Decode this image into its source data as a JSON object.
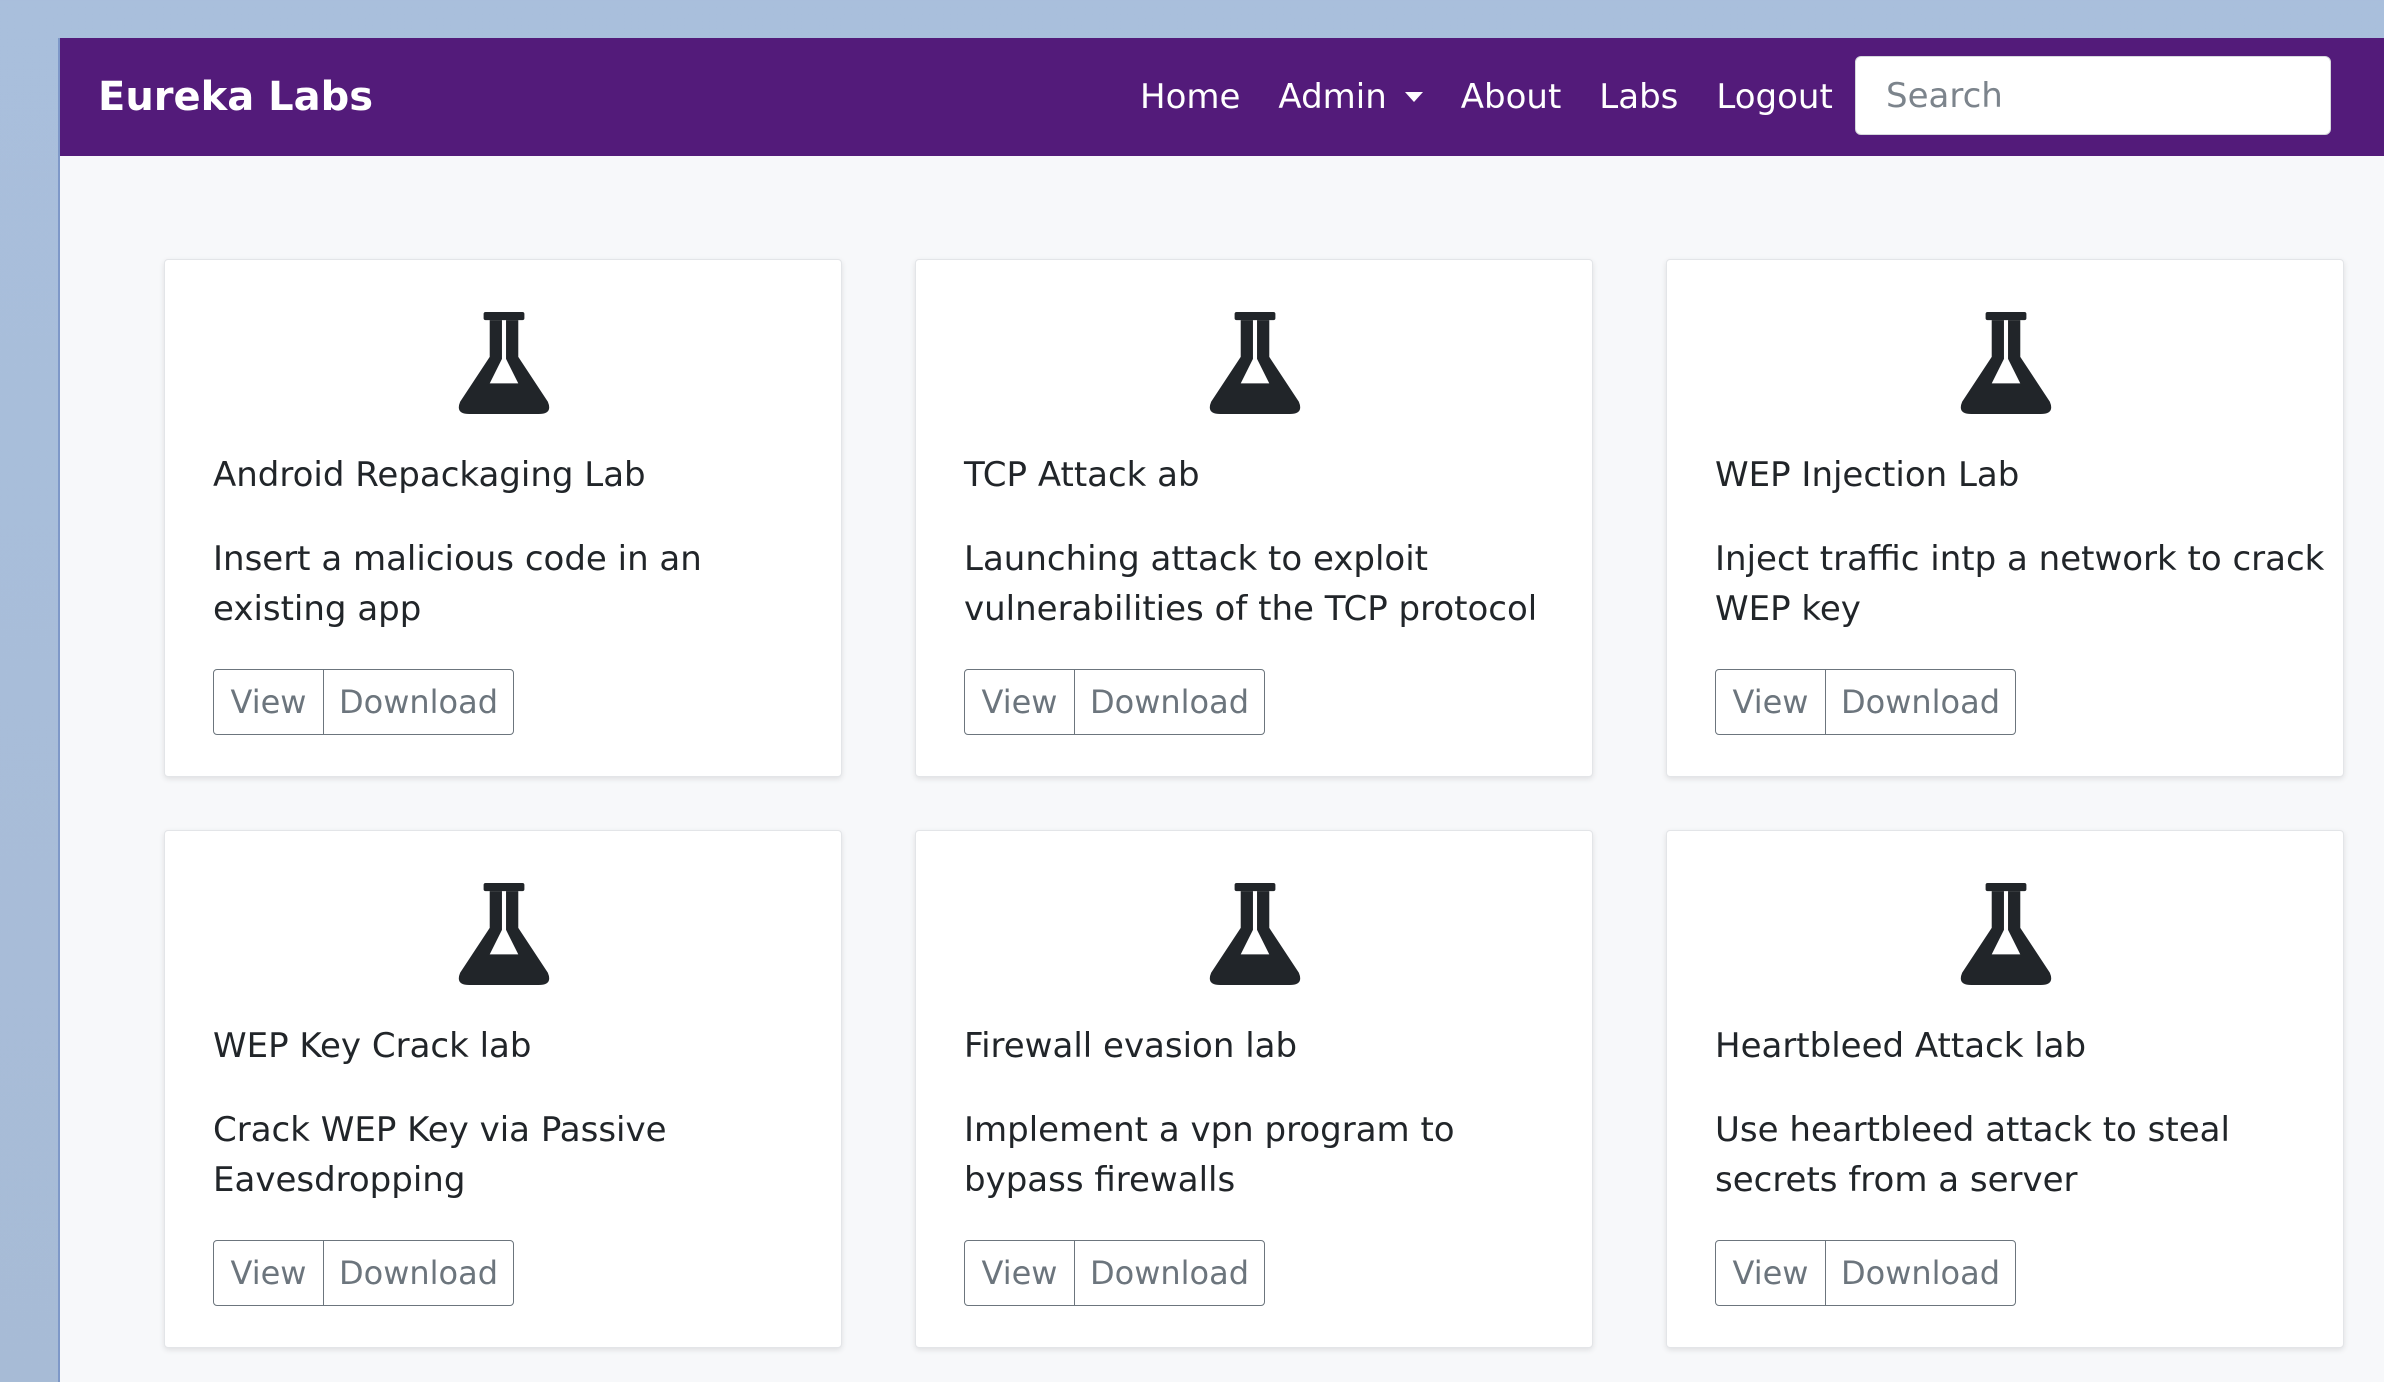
{
  "navbar": {
    "brand": "Eureka Labs",
    "links": [
      "Home",
      "Admin",
      "About",
      "Labs",
      "Logout"
    ],
    "search_placeholder": "Search"
  },
  "cards": [
    {
      "title": "Android Repackaging Lab",
      "description": "Insert a malicious code in an existing app",
      "view_label": "View",
      "download_label": "Download",
      "icon": "flask-icon"
    },
    {
      "title": "TCP Attack ab",
      "description": "Launching attack to exploit vulnerabilities of the TCP protocol",
      "view_label": "View",
      "download_label": "Download",
      "icon": "flask-icon"
    },
    {
      "title": "WEP Injection Lab",
      "description": "Inject traffic intp a network to crack WEP key",
      "view_label": "View",
      "download_label": "Download",
      "icon": "flask-icon"
    },
    {
      "title": "WEP Key Crack lab",
      "description": "Crack WEP Key via Passive Eavesdropping",
      "view_label": "View",
      "download_label": "Download",
      "icon": "flask-icon"
    },
    {
      "title": "Firewall evasion lab",
      "description": "Implement a vpn program to bypass firewalls",
      "view_label": "View",
      "download_label": "Download",
      "icon": "flask-icon"
    },
    {
      "title": "Heartbleed Attack lab",
      "description": "Use heartbleed attack to steal secrets from a server",
      "view_label": "View",
      "download_label": "Download",
      "icon": "flask-icon"
    }
  ],
  "colors": {
    "navbar": "#531b7a",
    "page_background": "#f7f8fa",
    "desktop_background": "#a9bfdc",
    "icon": "#212529",
    "button_outline": "#6c757d"
  }
}
